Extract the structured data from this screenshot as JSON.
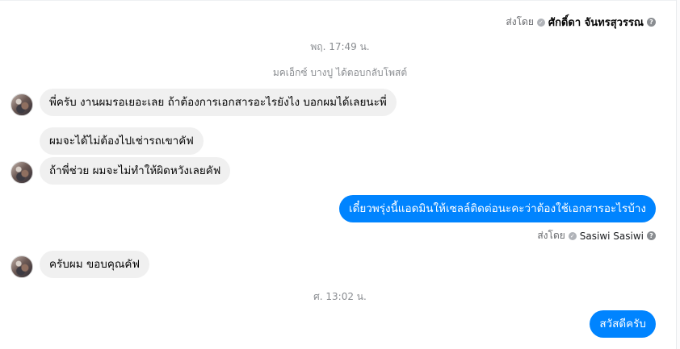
{
  "thread": {
    "sender_top": {
      "prefix": "ส่งโดย",
      "name": "ศักดิ์ดา จันทรสุวรรณ",
      "help_glyph": "?"
    },
    "timestamp_1": "พฤ. 17:49 น.",
    "system_note": "มคเอ็กซ์ บางปู ได้ตอบกลับโพสต์",
    "incoming": [
      "พี่ครับ งานผมรอเยอะเลย ถ้าต้องการเอกสารอะไรยังไง บอกผมได้เลยนะพี่",
      "ผมจะได้ไม่ต้องไปเช่ารถเขาคัฟ",
      "ถ้าพี่ช่วย ผมจะไม่ทำให้ผิดหวังเลยคัฟ",
      "ครับผม ขอบคุณคัฟ"
    ],
    "outgoing": [
      "เดี๋ยวพรุ่งนี้แอดมินให้เซลล์ติดต่อนะคะว่าต้องใช้เอกสารอะไรบ้าง",
      "สวัสดีครับ"
    ],
    "sender_bottom": {
      "prefix": "ส่งโดย",
      "name": "Sasiwi Sasiwi",
      "help_glyph": "?"
    },
    "timestamp_2": "ศ. 13:02 น."
  },
  "icons": {
    "verified": "verified-check-icon",
    "help": "help-circle-icon",
    "avatar": "user-avatar"
  },
  "colors": {
    "outgoing_bubble": "#0084ff",
    "incoming_bubble": "#f0f0f0",
    "meta_text": "#8a8d91"
  }
}
